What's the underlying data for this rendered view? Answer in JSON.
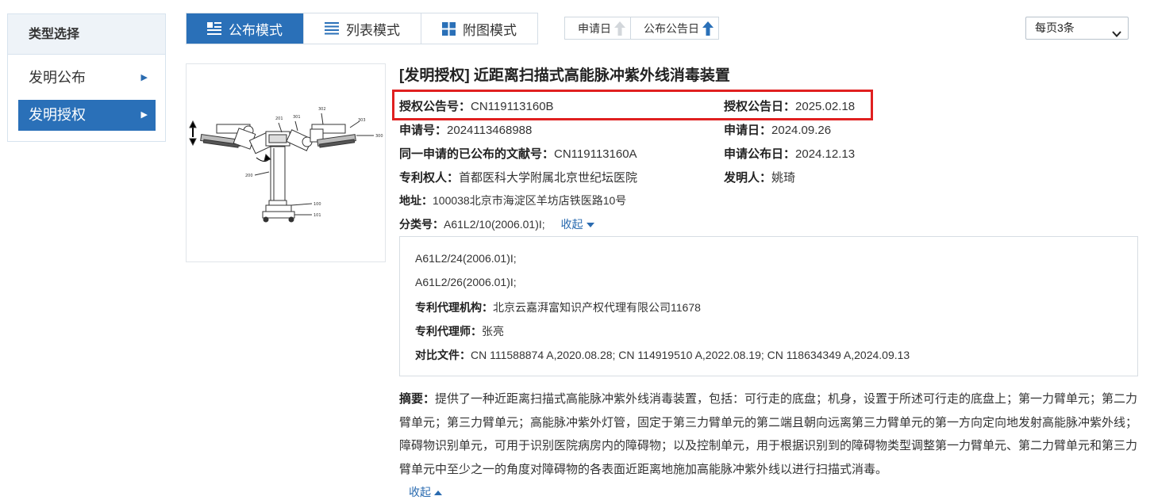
{
  "sidebar": {
    "header": "类型选择",
    "items": [
      {
        "label": "发明公布",
        "active": false
      },
      {
        "label": "发明授权",
        "active": true
      }
    ]
  },
  "toolbar": {
    "modes": [
      {
        "label": "公布模式",
        "icon": "publish-list-icon",
        "active": true
      },
      {
        "label": "列表模式",
        "icon": "list-icon",
        "active": false
      },
      {
        "label": "附图模式",
        "icon": "grid-icon",
        "active": false
      }
    ],
    "sort": [
      {
        "label": "申请日",
        "icon": "arrow-up-icon",
        "state": "inactive"
      },
      {
        "label": "公布公告日",
        "icon": "arrow-up-icon",
        "state": "active"
      }
    ],
    "page_size": "每页3条"
  },
  "record": {
    "title": "[发明授权] 近距离扫描式高能脉冲紫外线消毒装置",
    "grant_pub_no_label": "授权公告号：",
    "grant_pub_no": "CN119113160B",
    "grant_date_label": "授权公告日：",
    "grant_date": "2025.02.18",
    "app_no_label": "申请号：",
    "app_no": "2024113468988",
    "app_date_label": "申请日：",
    "app_date": "2024.09.26",
    "same_app_label": "同一申请的已公布的文献号：",
    "same_app": "CN119113160A",
    "app_pub_date_label": "申请公布日：",
    "app_pub_date": "2024.12.13",
    "patentee_label": "专利权人：",
    "patentee": "首都医科大学附属北京世纪坛医院",
    "inventor_label": "发明人：",
    "inventor": "姚琦",
    "address_label": "地址：",
    "address": "100038北京市海淀区羊坊店铁医路10号",
    "class_label": "分类号：",
    "class_no": "A61L2/10(2006.01)I;",
    "collapse_label": "收起",
    "class_more": [
      "A61L2/24(2006.01)I;",
      "A61L2/26(2006.01)I;"
    ],
    "agency_label": "专利代理机构：",
    "agency": "北京云嘉湃富知识产权代理有限公司11678",
    "agent_label": "专利代理师：",
    "agent": "张亮",
    "citations_label": "对比文件：",
    "citations": "CN 111588874 A,2020.08.28; CN 114919510 A,2022.08.19; CN 118634349 A,2024.09.13",
    "abstract_label": "摘要：",
    "abstract": "提供了一种近距离扫描式高能脉冲紫外线消毒装置，包括：可行走的底盘；机身，设置于所述可行走的底盘上；第一力臂单元；第二力臂单元；第三力臂单元；高能脉冲紫外灯管，固定于第三力臂单元的第二端且朝向远离第三力臂单元的第一方向定向地发射高能脉冲紫外线；障碍物识别单元，可用于识别医院病房内的障碍物；以及控制单元，用于根据识别到的障碍物类型调整第一力臂单元、第二力臂单元和第三力臂单元中至少之一的角度对障碍物的各表面近距离地施加高能脉冲紫外线以进行扫描式消毒。",
    "abstract_collapse": "收起",
    "figure_labels": [
      "201",
      "301",
      "302",
      "303",
      "300",
      "200",
      "100",
      "101"
    ]
  },
  "colors": {
    "accent": "#2a70b8",
    "highlight": "#e02020",
    "link": "#2a6bb0"
  }
}
